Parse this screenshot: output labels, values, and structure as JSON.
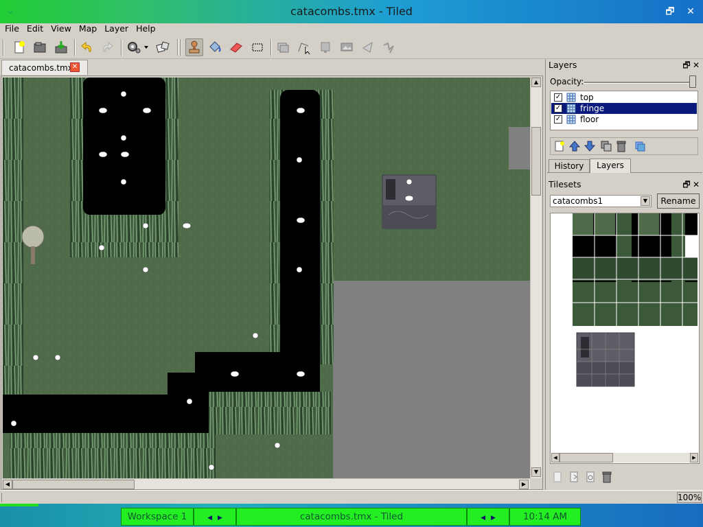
{
  "window": {
    "title": "catacombs.tmx - Tiled",
    "menu_icon": "menu-icon",
    "restore_icon": "restore-icon",
    "close_icon": "close-icon"
  },
  "menubar": [
    "File",
    "Edit",
    "View",
    "Map",
    "Layer",
    "Help"
  ],
  "toolbar": {
    "icons": [
      "new-file-icon",
      "open-file-icon",
      "save-file-icon",
      "undo-icon",
      "redo-icon",
      "commands-icon",
      "random-mode-icon",
      "stamp-brush-icon",
      "bucket-fill-icon",
      "eraser-icon",
      "rectangle-select-icon",
      "object-select-icon",
      "edit-polygon-icon",
      "insert-rectangle-icon",
      "insert-image-icon",
      "insert-polygon-icon",
      "insert-polyline-icon"
    ],
    "active_tool": "stamp-brush-icon"
  },
  "document_tabs": [
    {
      "label": "catacombs.tmx",
      "close_icon": "tab-close-icon"
    }
  ],
  "layers_panel": {
    "title": "Layers",
    "opacity_label": "Opacity:",
    "opacity": 1.0,
    "layers": [
      {
        "name": "top",
        "visible": true,
        "selected": false
      },
      {
        "name": "fringe",
        "visible": true,
        "selected": true
      },
      {
        "name": "floor",
        "visible": true,
        "selected": false
      }
    ],
    "tools": [
      "add-layer-icon",
      "raise-layer-icon",
      "lower-layer-icon",
      "duplicate-layer-icon",
      "delete-layer-icon",
      "layer-properties-icon"
    ],
    "tabs": [
      "History",
      "Layers"
    ],
    "active_tab": "Layers"
  },
  "tilesets_panel": {
    "title": "Tilesets",
    "selected_tileset": "catacombs1",
    "rename_label": "Rename",
    "tools": [
      "new-tileset-icon",
      "import-tileset-icon",
      "tileset-properties-icon",
      "delete-tileset-icon"
    ]
  },
  "statusbar": {
    "zoom": "100%"
  },
  "taskbar": {
    "workspace": "Workspace 1",
    "task": "catacombs.tmx - Tiled",
    "clock": "10:14 AM"
  },
  "colors": {
    "grass": "#4f6b4a",
    "pit": "#000000",
    "void": "#808080",
    "selection": "#0a1a7c",
    "taskbar_cell": "#22ee22"
  }
}
